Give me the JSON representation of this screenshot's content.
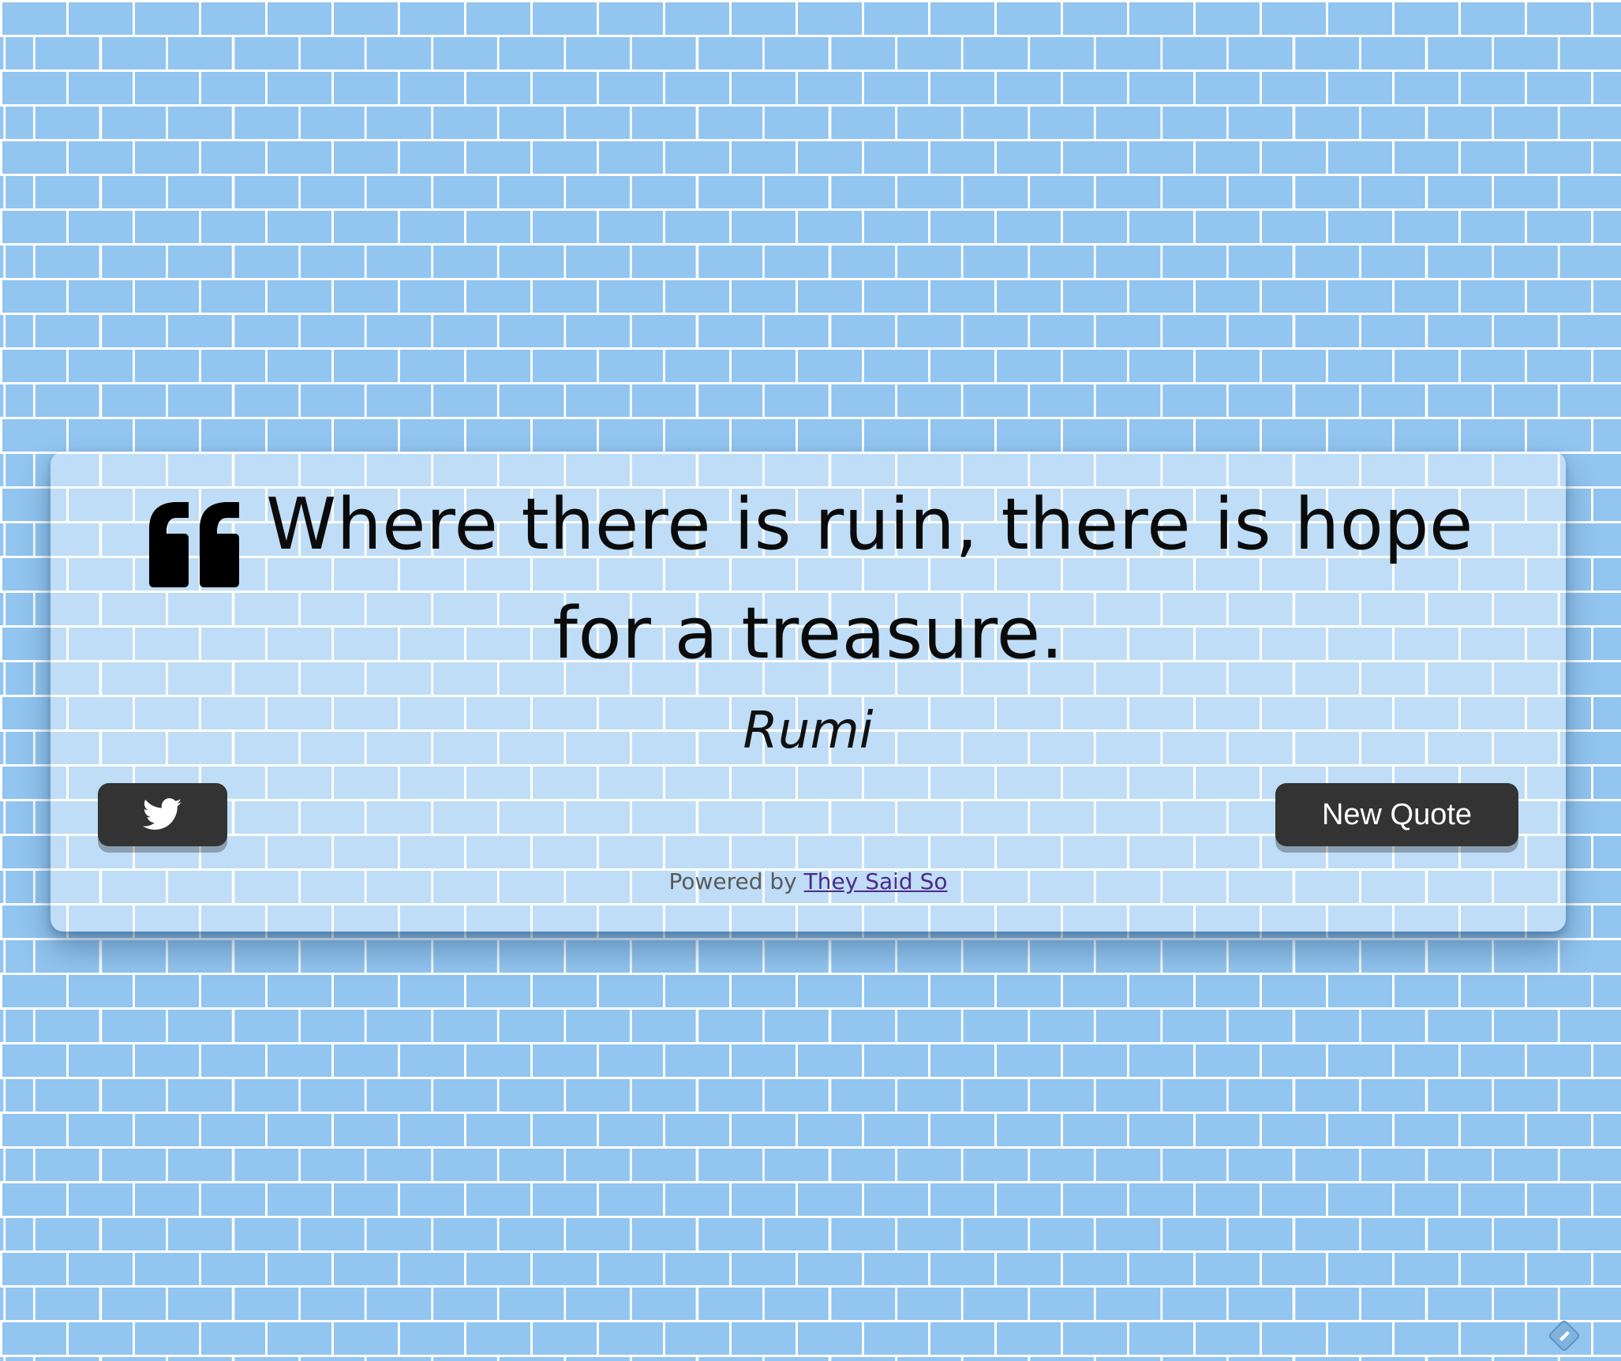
{
  "quote": {
    "text": "Where there is ruin, there is hope for a treasure.",
    "author": "Rumi"
  },
  "buttons": {
    "tweet_icon": "twitter-icon",
    "new_quote_label": "New Quote"
  },
  "footer": {
    "powered_prefix": "Powered by",
    "powered_link": "They Said So"
  },
  "colors": {
    "background": "#92c5ef",
    "mortar": "#ffffff",
    "button": "#333333",
    "link": "#4b2a8a"
  }
}
